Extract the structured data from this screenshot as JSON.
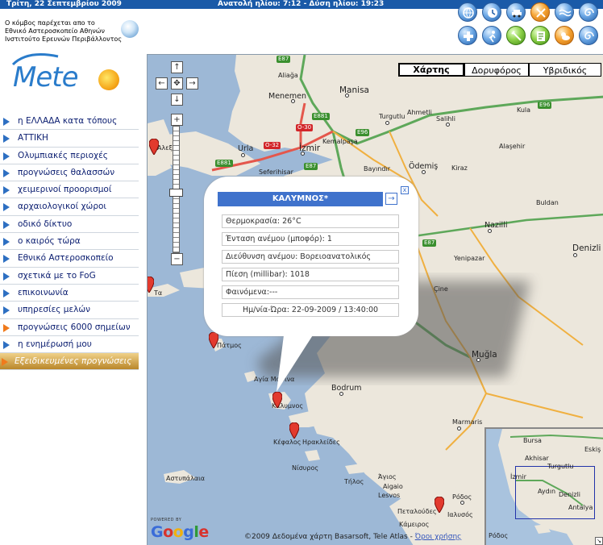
{
  "topbar": {
    "date": "Τρίτη, 22 Σεπτεμβρίου 2009",
    "sun": "Ανατολή ηλίου: 7:12 - Δύση ηλίου: 19:23"
  },
  "toolbar_icons": [
    {
      "name": "globe-icon"
    },
    {
      "name": "clock-icon"
    },
    {
      "name": "car-icon"
    },
    {
      "name": "sun-icon"
    },
    {
      "name": "waves-icon"
    },
    {
      "name": "spiral-icon"
    },
    {
      "name": "medical-icon"
    },
    {
      "name": "walking-icon"
    },
    {
      "name": "tools-icon"
    },
    {
      "name": "document-icon"
    },
    {
      "name": "weather-icon"
    },
    {
      "name": "storm-icon"
    }
  ],
  "provider": {
    "line1": "Ο κόμβος παρέχεται απο το",
    "line2": "Εθνικό Αστεροσκοπείο  Αθηνών",
    "line3": "Ινστιτούτο Ερευνών  Περιβάλλοντος"
  },
  "logo": {
    "text": "Mete"
  },
  "menu": [
    {
      "label": "η ΕΛΛΑΔΑ κατα τόπους"
    },
    {
      "label": "ΑΤΤΙΚΗ"
    },
    {
      "label": "Ολυμπιακές περιοχές"
    },
    {
      "label": "προγνώσεις θαλασσών"
    },
    {
      "label": "χειμερινοί προορισμοί"
    },
    {
      "label": "αρχαιολογικοί χώροι"
    },
    {
      "label": "οδικό δίκτυο"
    },
    {
      "label": "ο καιρός τώρα"
    },
    {
      "label": "Εθνικό Αστεροσκοπείο"
    },
    {
      "label": "σχετικά με το FoG"
    },
    {
      "label": "επικοινωνία"
    },
    {
      "label": "υπηρεσίες μελών"
    },
    {
      "label": "προγνώσεις 6000 σημείων"
    },
    {
      "label": "η ενημέρωσή μου"
    },
    {
      "label": "Εξειδικευμένες προγνώσεις"
    }
  ],
  "map": {
    "types": [
      "Χάρτης",
      "Δορυφόρος",
      "Υβριδικός"
    ],
    "active_type": "Χάρτης",
    "nav": {
      "up": "↑",
      "left": "←",
      "center": "✥",
      "right": "→",
      "down": "↓",
      "zoom_in": "+",
      "zoom_out": "−"
    },
    "labels": {
      "aliaga": "Aliağa",
      "menemen": "Menemen",
      "manisa": "Manisa",
      "turgutlu": "Turgutlu",
      "ahmetli": "Ahmetli",
      "salihli": "Salihli",
      "kula": "Kula",
      "alasehir": "Alaşehir",
      "kemalpasa": "Kemalpaşa",
      "izmir": "İzmir",
      "urla": "Urla",
      "seferihisar": "Seferihisar",
      "bayindir": "Bayındır",
      "odemis": "Ödemiş",
      "kiraz": "Kiraz",
      "buldan": "Buldan",
      "nazilli": "Nazilli",
      "yenipazar": "Yenipazar",
      "denizli": "Denizli",
      "cine": "Çine",
      "mugla": "Muğla",
      "marmaris": "Marmaris",
      "bodrum": "Bodrum",
      "agia_marina": "Αγία Μαρίνα",
      "kalymnos": "Κάλυμνος",
      "kefalos": "Κέφαλος",
      "irakleides": "Ηρακλείδες",
      "nisyros": "Νίσυρος",
      "astypalaia": "Αστυπάλαια",
      "tilos": "Τήλος",
      "agios": "Άγιος",
      "aigaio": "Aigaio",
      "lesvos": "Lesvos",
      "rodos": "Ρόδος",
      "ialysos": "Ιαλυσός",
      "petaloudes": "Πεταλούδες",
      "kameiros": "Κάμειρος",
      "patmos": "Πάτμος",
      "ta": "Τα",
      "alexandr": "Αλεξ"
    },
    "roads": {
      "e87a": "E87",
      "e881a": "E881",
      "e96a": "E96",
      "e96b": "E96",
      "o30": "O-30",
      "o32": "O-32",
      "e87b": "E87",
      "e881b": "E881",
      "e87c": "E87"
    },
    "powered_by": "POWERED BY",
    "google": "Google",
    "copyright": "©2009 Δεδομένα χάρτη Basarsoft, Tele Atlas - ",
    "terms": "Όροι χρήσης"
  },
  "popup": {
    "title": "ΚΑΛΥΜΝΟΣ*",
    "go": "→",
    "close": "x",
    "rows": [
      "Θερμοκρασία: 26°C",
      "Ένταση ανέμου (μποφόρ): 1",
      "Διεύθυνση ανέμου: Βορειοανατολικός",
      "Πίεση (millibar): 1018",
      "Φαινόμενα:---",
      "Ημ/νία-Ώρα: 22-09-2009 / 13:40:00"
    ]
  },
  "overview": {
    "bursa": "Bursa",
    "eskis": "Eskiş",
    "akhisar": "Akhisar",
    "turgutlu": "Turgutlu",
    "izmir": "İzmir",
    "aydin": "Aydın",
    "denizli": "Denizli",
    "antalya": "Antalya",
    "rodos": "Ρόδος"
  }
}
